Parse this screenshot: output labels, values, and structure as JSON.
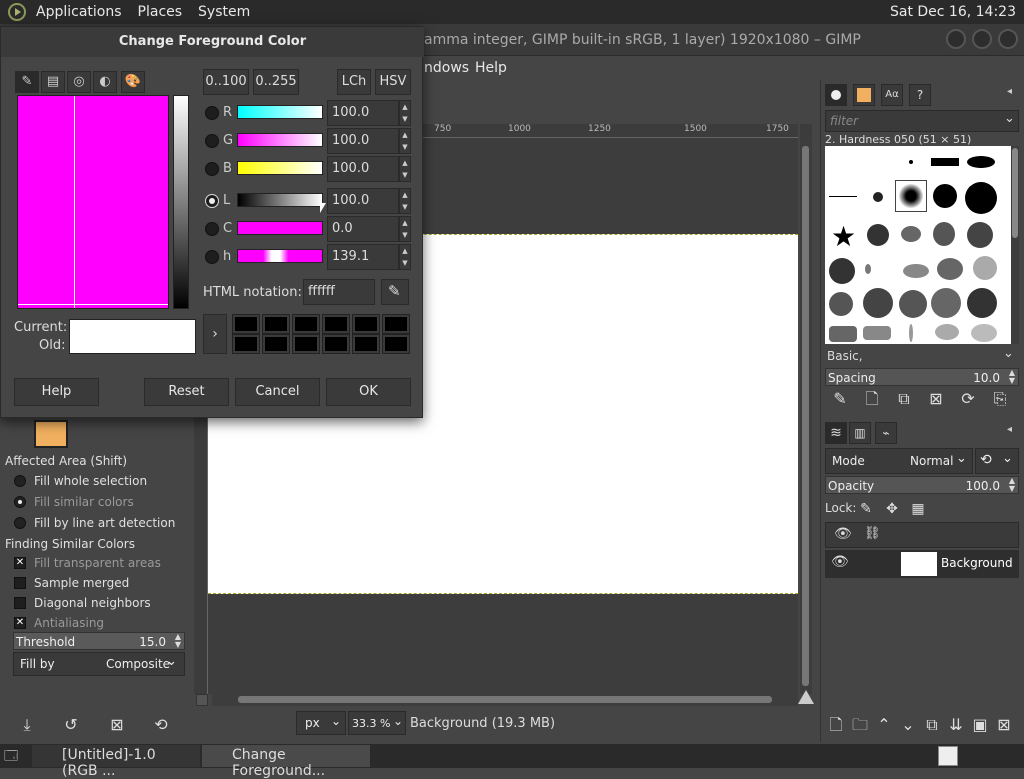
{
  "topbar": {
    "applications": "Applications",
    "places": "Places",
    "system": "System",
    "clock": "Sat Dec 16, 14:23"
  },
  "gimp": {
    "title": "amma integer, GIMP built-in sRGB, 1 layer) 1920x1080 – GIMP",
    "menu_windows": "ndows",
    "menu_help": "Help"
  },
  "dialog": {
    "title": "Change Foreground Color",
    "range_100": "0..100",
    "range_255": "0..255",
    "lch": "LCh",
    "hsv": "HSV",
    "channels": [
      {
        "label": "R",
        "value": "100.0"
      },
      {
        "label": "G",
        "value": "100.0"
      },
      {
        "label": "B",
        "value": "100.0"
      },
      {
        "label": "L",
        "value": "100.0"
      },
      {
        "label": "C",
        "value": "0.0"
      },
      {
        "label": "h",
        "value": "139.1"
      }
    ],
    "html_label": "HTML notation:",
    "html_value": "ffffff",
    "current_label": "Current:",
    "old_label": "Old:",
    "help": "Help",
    "reset": "Reset",
    "cancel": "Cancel",
    "ok": "OK",
    "square_color": "#ff00ff"
  },
  "tool_options": {
    "affected_area": "Affected Area  (Shift)",
    "fill_whole": "Fill whole selection",
    "fill_similar": "Fill similar colors",
    "fill_line_art": "Fill by line art detection",
    "finding_similar": "Finding Similar Colors",
    "fill_transparent": "Fill transparent areas",
    "sample_merged": "Sample merged",
    "diagonal": "Diagonal neighbors",
    "antialiasing": "Antialiasing",
    "threshold_label": "Threshold",
    "threshold_value": "15.0",
    "fill_by_label": "Fill by",
    "fill_by_value": "Composite"
  },
  "ruler": {
    "t750": "750",
    "t1000": "1000",
    "t1250": "1250",
    "t1500": "1500",
    "t1750": "1750"
  },
  "status": {
    "unit": "px",
    "zoom": "33.3 %",
    "info": "Background (19.3 MB)"
  },
  "brushes": {
    "filter_placeholder": "filter",
    "brush_name": "2. Hardness 050 (51 × 51)",
    "tag": "Basic,",
    "spacing_label": "Spacing",
    "spacing_value": "10.0"
  },
  "layers": {
    "mode_label": "Mode",
    "mode_value": "Normal",
    "opacity_label": "Opacity",
    "opacity_value": "100.0",
    "lock_label": "Lock:",
    "layer_name": "Background"
  },
  "taskbar": {
    "task1": "[Untitled]-1.0 (RGB ...",
    "task2": "Change Foreground..."
  }
}
